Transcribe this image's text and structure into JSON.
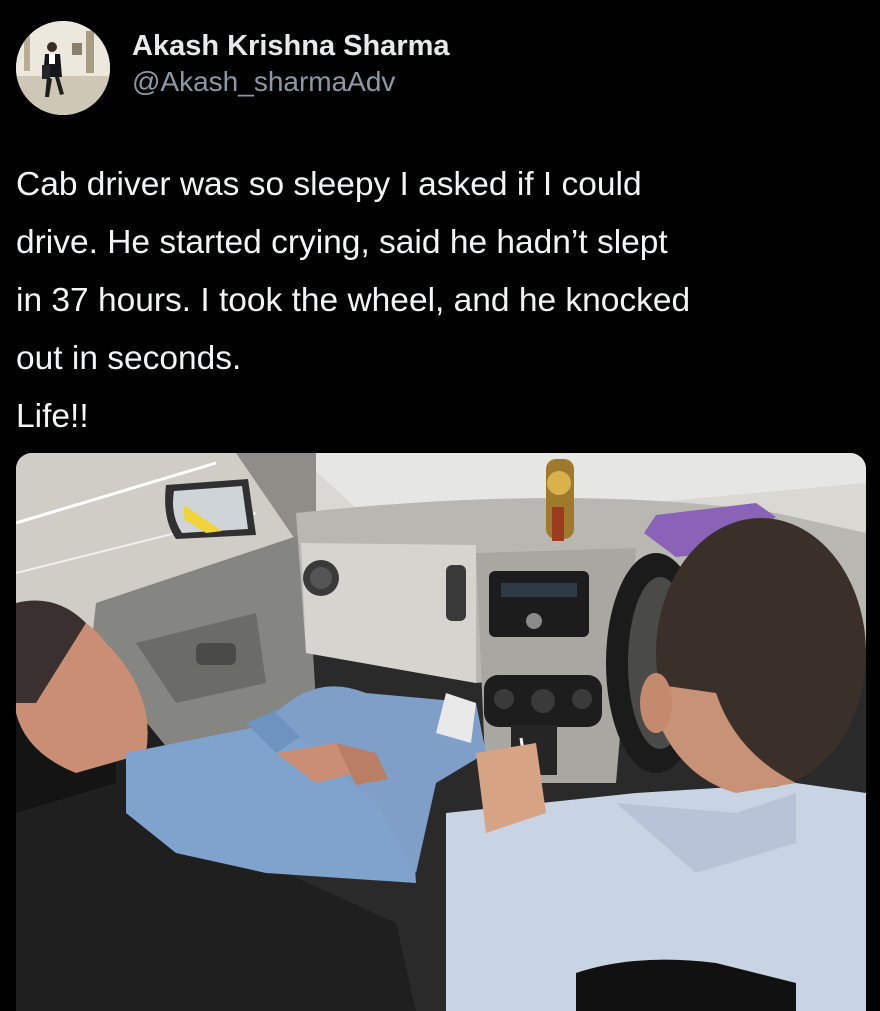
{
  "author": {
    "display_name": "Akash Krishna Sharma",
    "handle": "@Akash_sharmaAdv",
    "avatar_icon": "profile-photo-person-walking"
  },
  "tweet": {
    "lines": [
      "Cab driver was so sleepy I asked if I could",
      "drive. He started crying, said he hadn’t slept",
      "in 37 hours. I took the wheel, and he knocked",
      "out in seconds.",
      "Life!!"
    ]
  },
  "media": {
    "kind": "photo",
    "subject_icon": "car-interior-photo"
  },
  "colors": {
    "background": "#000000",
    "name": "#e7e9ea",
    "handle": "#8b98a5",
    "text": "#f2f4f5"
  }
}
